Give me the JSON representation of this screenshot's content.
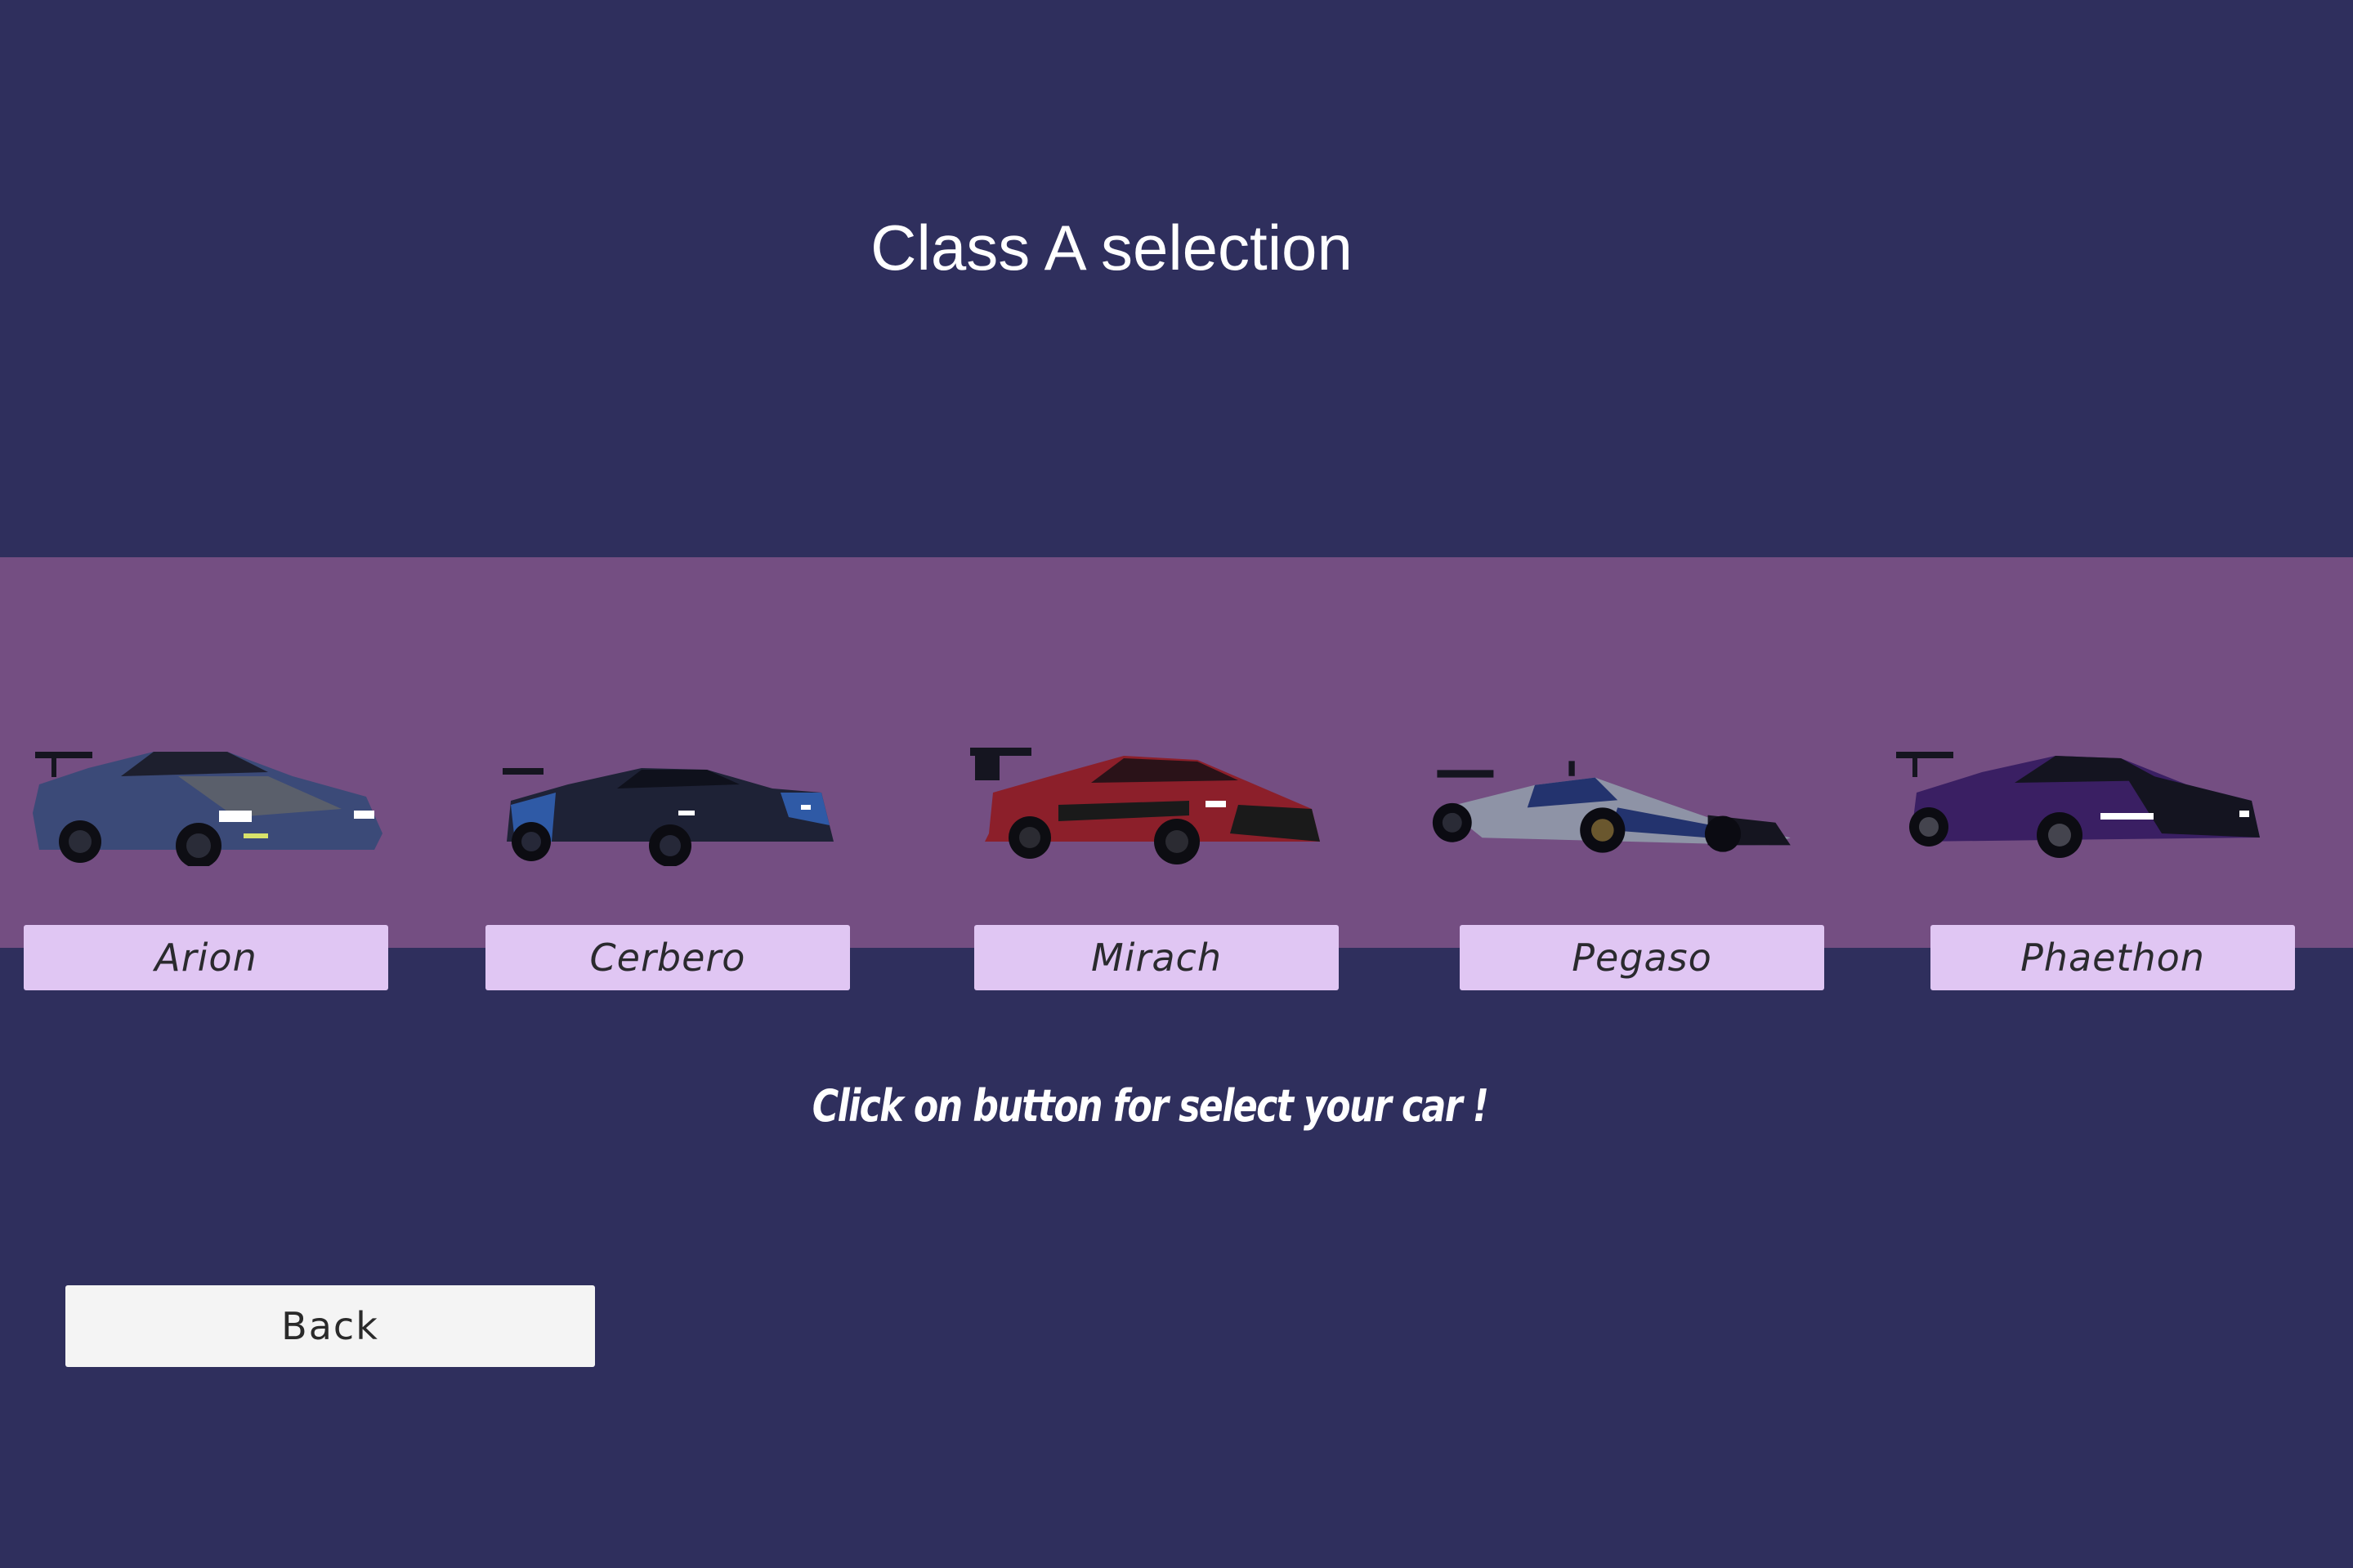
{
  "screen": {
    "title": "Class A selection",
    "hint": "Click on button for select your car !",
    "back_label": "Back"
  },
  "cars": [
    {
      "name": "Arion",
      "body_color": "#3b4a78",
      "accent_color": "#5a5f6b"
    },
    {
      "name": "Cerbero",
      "body_color": "#1e2236",
      "accent_color": "#2f5aa6"
    },
    {
      "name": "Mirach",
      "body_color": "#8c1f2a",
      "accent_color": "#1a1a1a"
    },
    {
      "name": "Pegaso",
      "body_color": "#8e93a6",
      "accent_color": "#23336e"
    },
    {
      "name": "Phaethon",
      "body_color": "#3a1f63",
      "accent_color": "#141420"
    }
  ],
  "colors": {
    "background": "#2f2f5d",
    "band": "#744e82",
    "car_button": "#e0c6f3",
    "back_button": "#f4f4f4"
  }
}
